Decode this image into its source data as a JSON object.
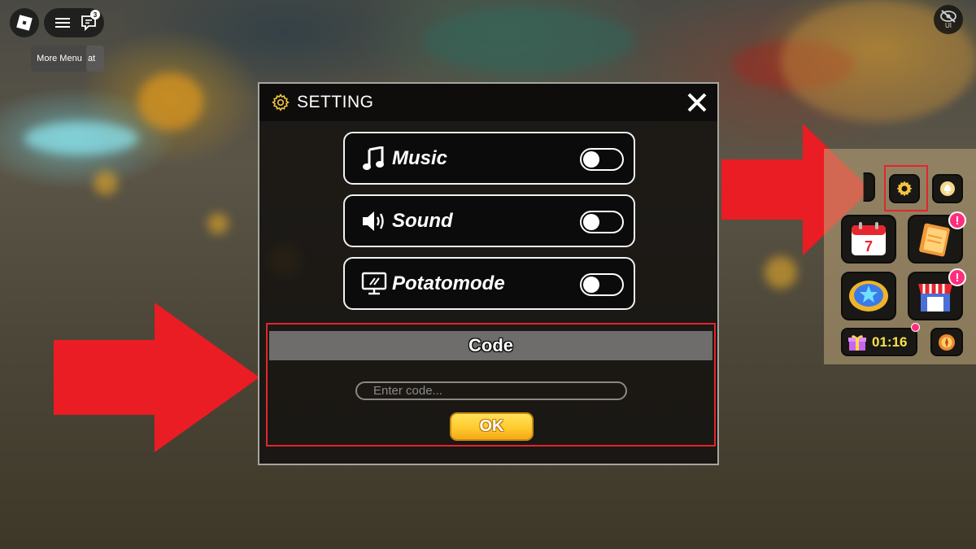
{
  "topbar": {
    "chat_badge_count": "3",
    "tooltip_more_menu": "More Menu",
    "tooltip_chat_fragment": "at",
    "hide_ui_label": "UI"
  },
  "modal": {
    "title": "SETTING",
    "toggles": [
      {
        "label": "Music",
        "icon": "music-note-icon",
        "state": "off"
      },
      {
        "label": "Sound",
        "icon": "speaker-icon",
        "state": "off"
      },
      {
        "label": "Potatomode",
        "icon": "monitor-icon",
        "state": "off"
      }
    ],
    "code": {
      "header": "Code",
      "placeholder": "Enter code...",
      "ok_label": "OK"
    }
  },
  "side_panel": {
    "timer": "01:16",
    "icons": [
      "settings-gear-icon",
      "bell-icon",
      "calendar-icon",
      "clipboard-quest-icon",
      "medal-badge-icon",
      "shop-icon",
      "gift-icon",
      "compass-icon"
    ],
    "calendar_day": "7"
  },
  "colors": {
    "annotation_red": "#e3262b",
    "ok_yellow": "#ffcb2e",
    "timer_yellow": "#f6e24a",
    "badge_pink": "#ff2e7d"
  }
}
